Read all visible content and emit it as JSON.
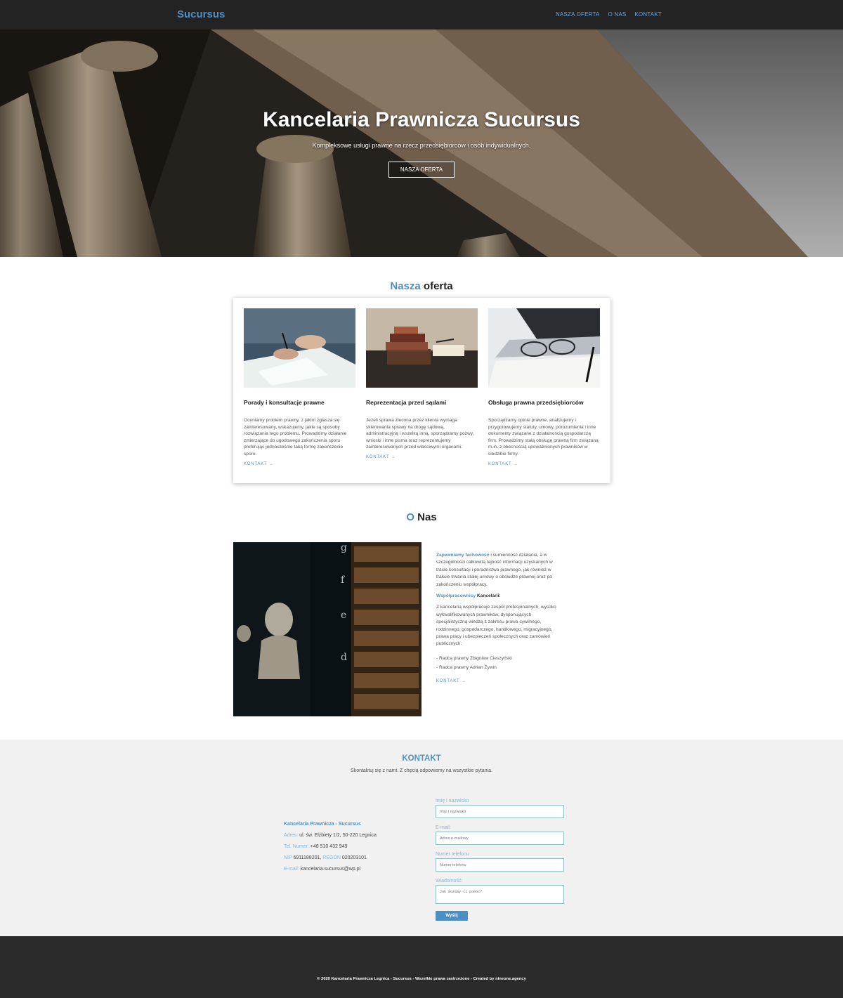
{
  "nav": {
    "brand": "Sucursus",
    "links": [
      "NASZA OFERTA",
      "O NAS",
      "KONTAKT"
    ]
  },
  "hero": {
    "title": "Kancelaria Prawnicza Sucursus",
    "subtitle": "Kompleksowe usługi prawne na rzecz przedsiębiorców i osób indywidualnych.",
    "cta_label": "NASZA OFERTA"
  },
  "offer": {
    "title_accent": "Nasza",
    "title_rest": " oferta",
    "items": [
      {
        "title": "Porady i konsultacje prawne",
        "text": "Oceniamy problem prawny, z jakim zgłasza się zainteresowany, wskazujemy, jakie są sposoby rozwiązania tego problemu. Prowadzimy działanie zmierzające do ugodowego zakończenia sporu preferując jednocześnie taką formę zakończenie sporu.",
        "link": "KONTAKT →"
      },
      {
        "title": "Reprezentacja przed sądami",
        "text": "Jeżeli sprawa zlecona przez klienta wymaga skierowania sprawy na drogę sądową, administracyjną i wszelką inną, sporządzamy pozwy, wnioski i inne pisma oraz reprezentujemy zainteresowanych przed właściwymi organami.",
        "link": "KONTAKT →"
      },
      {
        "title": "Obsługa prawna przedsiębiorców",
        "text": "Sporządzamy opinie prawne, analizujemy i przygotowujemy statuty, umowy, porozumienia i inne dokumenty związane z działalnością gospodarczą firm. Prowadzimy stałą obsługę prawną firm związaną m.in. z obecnością upoważnionych prawników w siedzibie firmy.",
        "link": "KONTAKT →"
      }
    ]
  },
  "about": {
    "title_accent": "O",
    "title_rest": " Nas",
    "p1_highlight": "Zapewniamy fachowość",
    "p1_text": " i sumienność działania, a w szczególności całkowitą tajność informacji uzyskanych w tracie konsultacji i poradnictwa prawnego, jak również w trakcie trwania stałej umowy o obsłudze prawnej oraz po zakończeniu współpracy.",
    "p2_highlight": "Współpracownicy",
    "p2_text": " Kancelarii:",
    "p3_text": "Z kancelarią współpracuje zespół profesjonalnych, wysoko wykwalifikowanych prawników, dysponujących specjalistyczną wiedzą z zakresu prawa cywilnego, rodzinnego, gospodarczego, handlowego, migracyjnego, prawa pracy i ubezpieczeń społecznych oraz zamówień publicznych.",
    "people": [
      "- Radca prawny Zbigniew Cieszyński",
      "- Radca prawny Adrian Żywin"
    ],
    "link": "KONTAKT →"
  },
  "contact": {
    "title": "KONTAKT",
    "lead": "Skontaktuj się z nami. Z chęcią odpowiemy na wszystkie pytania.",
    "company": "Kancelaria Prawnicza - Sucursus",
    "address_label": "Adres:",
    "address": " ul. św. Elżbiety 1/2, 50-220 Legnica",
    "phone_label": "Tel. Numer:",
    "phone": " +48 510 432 949",
    "nip_label": "NIP",
    "nip": " 6911188201, ",
    "regon_label": "REGON",
    "regon": " 020203101",
    "email_label": "E-mail:",
    "email": " kancelaria.sucursus@wp.pl",
    "form": {
      "name_label": "Imię i nazwisko",
      "name_placeholder": "Imię i nazwisko",
      "email_label": "E-mail:",
      "email_placeholder": "Adres e-mailowy",
      "phone_label": "Numer telefonu",
      "phone_placeholder": "Numer telefonu",
      "message_label": "Wiadomość:",
      "message_placeholder": "Jak możemy ci pomóc?",
      "send_label": "Wyślij"
    }
  },
  "footer": {
    "copyright": "© 2020 Kancelaria Prawnicza Legnica - Sucursus - Wszelkie prawa zastrzeżone - Created by nineone.agency"
  },
  "colors": {
    "accent": "#4d8fc4",
    "nav_bg": "#232323",
    "footer_bg": "#2b2b2b",
    "contact_bg": "#f1f1f1"
  }
}
